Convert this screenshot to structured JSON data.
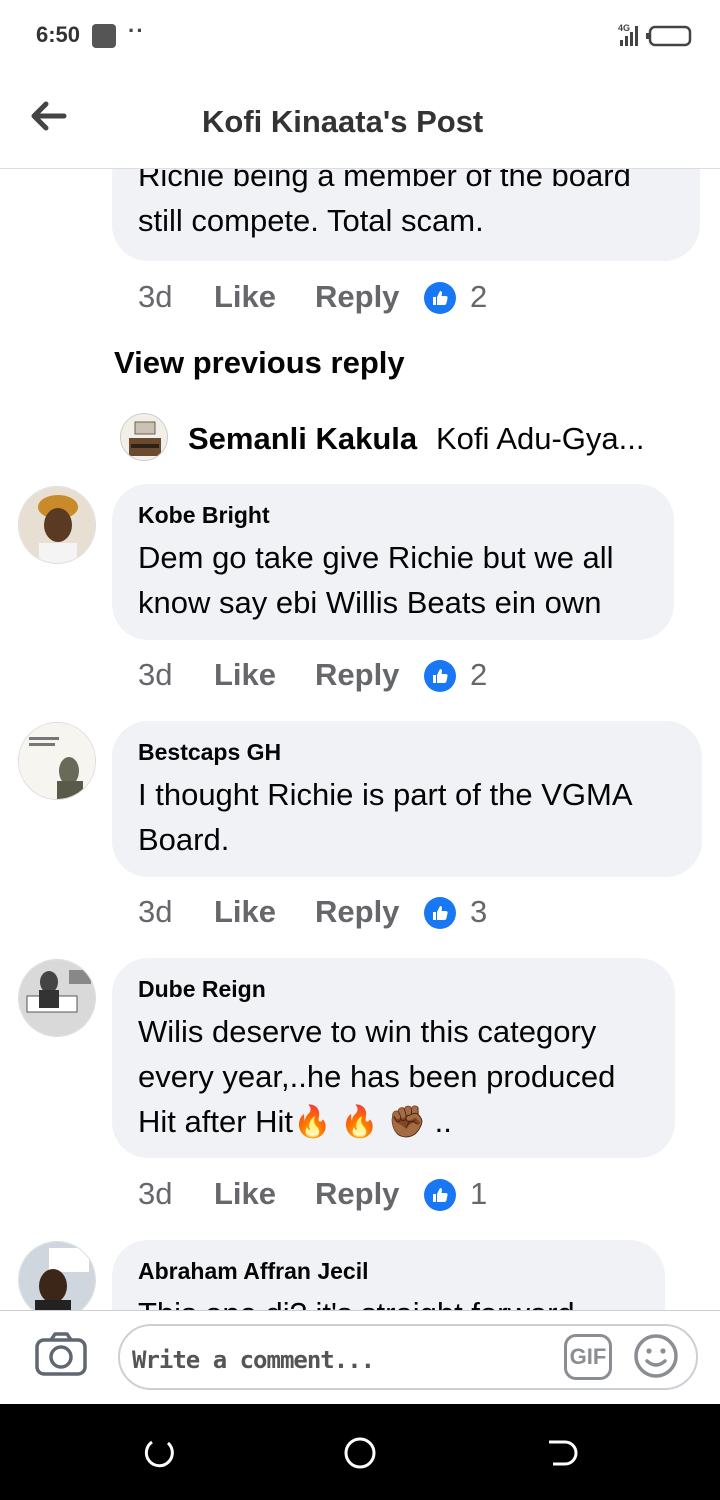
{
  "status_bar": {
    "time": "6:50",
    "dots": "··",
    "network": "4G"
  },
  "header": {
    "title": "Kofi Kinaata's Post"
  },
  "comments": [
    {
      "author": "",
      "lines": [
        "Richie being a member of the board",
        "still compete. Total scam."
      ],
      "time": "3d",
      "like": "Like",
      "reply": "Reply",
      "likes": "2"
    },
    {
      "author": "Kobe Bright",
      "lines": [
        "Dem go take give Richie but we all",
        "know say ebi Willis Beats ein own"
      ],
      "time": "3d",
      "like": "Like",
      "reply": "Reply",
      "likes": "2"
    },
    {
      "author": "Bestcaps GH",
      "lines": [
        "I thought Richie is part of the VGMA",
        "Board."
      ],
      "time": "3d",
      "like": "Like",
      "reply": "Reply",
      "likes": "3"
    },
    {
      "author": "Dube Reign",
      "lines": [
        "Wilis deserve to win this category",
        "every year,..he has been produced",
        "Hit after Hit"
      ],
      "emoji_tail": "🔥 🔥 ✊🏾 ..",
      "time": "3d",
      "like": "Like",
      "reply": "Reply",
      "likes": "1"
    },
    {
      "author": "Abraham Affran Jecil",
      "lines": [
        "This one di? it's straight forward"
      ]
    }
  ],
  "view_previous": "View previous reply",
  "mini_reply": {
    "name": "Semanli Kakula",
    "text": "Kofi Adu-Gya..."
  },
  "composer": {
    "placeholder": "Write a comment...",
    "gif": "GIF"
  },
  "colors": {
    "bubble": "#f0f2f5",
    "like_blue": "#1877f2",
    "meta_gray": "#65676b"
  },
  "icons": [
    "back-arrow-icon",
    "camera-icon",
    "gif-icon",
    "emoji-icon",
    "like-thumb-icon",
    "signal-icon",
    "battery-icon",
    "recent-apps-icon",
    "home-icon",
    "back-nav-icon"
  ]
}
